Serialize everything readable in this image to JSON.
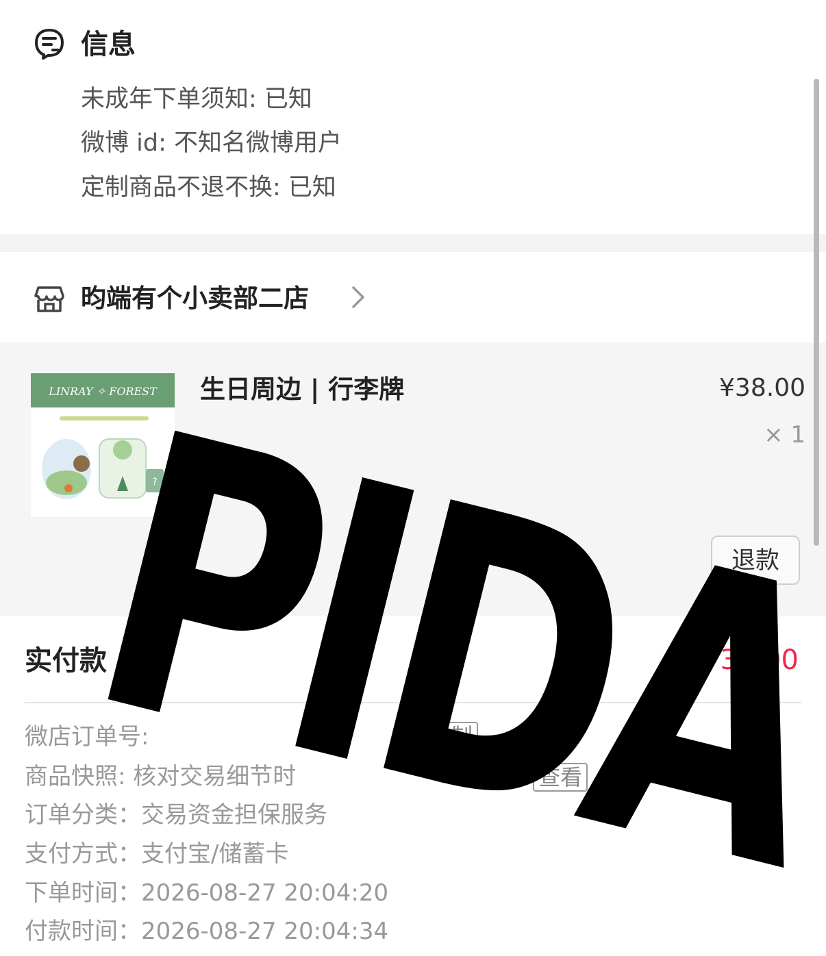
{
  "info": {
    "title": "信息",
    "lines": [
      "未成年下单须知: 已知",
      "微博 id: 不知名微博用户",
      "定制商品不退不换: 已知"
    ]
  },
  "store": {
    "name": "昀端有个小卖部二店"
  },
  "product": {
    "title": "生日周边 | 行李牌",
    "price": "¥38.00",
    "quantity": "× 1",
    "refund_label": "退款",
    "image_brand_text": "LINRAY ✧ FOREST"
  },
  "payment": {
    "paid_label": "实付款",
    "paid_amount": "38.00"
  },
  "order_details": [
    {
      "label": "微店订单号:",
      "value": ""
    },
    {
      "label": "商品快照:",
      "value": "核对交易细节时"
    },
    {
      "label": "订单分类：",
      "value": "交易资金担保服务"
    },
    {
      "label": "支付方式：",
      "value": "支付宝/储蓄卡"
    },
    {
      "label": "下单时间：",
      "value": "2026-08-27 20:04:20"
    },
    {
      "label": "付款时间：",
      "value": "2026-08-27 20:04:34"
    }
  ],
  "detail_chips": {
    "copy": "制",
    "view": "查看"
  },
  "watermark": "PIDA",
  "colors": {
    "price_red": "#f0284a",
    "product_banner_green": "#6a9e73",
    "card_background": "#f5f5f5"
  }
}
